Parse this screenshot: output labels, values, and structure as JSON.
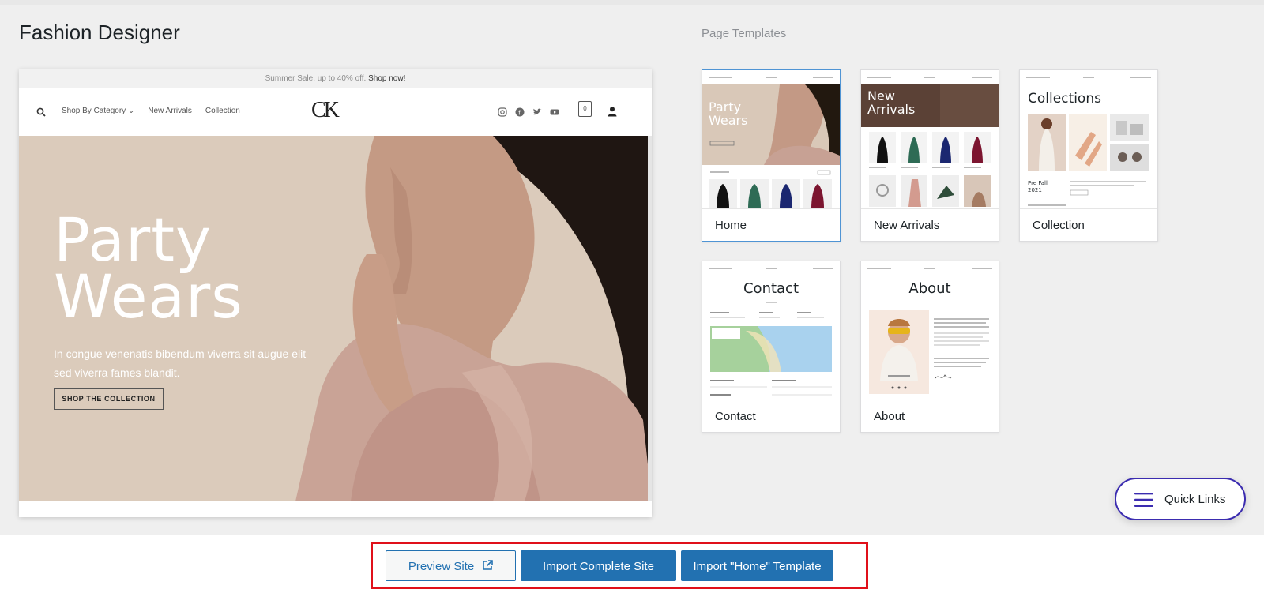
{
  "site_title": "Fashion Designer",
  "preview": {
    "announcement_text": "Summer Sale, up to 40% off.",
    "announcement_link": "Shop now!",
    "nav_links": [
      "Shop By Category ⌄",
      "New Arrivals",
      "Collection"
    ],
    "logo": "CK",
    "cart_count": "0",
    "hero_title": "Party\nWears",
    "hero_subtitle": "In congue venenatis bibendum viverra sit augue elit sed viverra fames blandit.",
    "hero_button": "SHOP THE COLLECTION"
  },
  "templates": {
    "heading": "Page Templates",
    "selected": "Home",
    "items": [
      {
        "label": "Home",
        "thumb_title": "Party Wears"
      },
      {
        "label": "New Arrivals",
        "thumb_title": "New Arrivals"
      },
      {
        "label": "Collection",
        "thumb_title": "Collections",
        "thumb_caption": "Pre Fall 2021"
      },
      {
        "label": "Contact",
        "thumb_title": "Contact"
      },
      {
        "label": "About",
        "thumb_title": "About"
      }
    ]
  },
  "quick_links": {
    "label": "Quick Links",
    "icon": "hamburger-icon"
  },
  "actions": {
    "preview_site": "Preview Site",
    "preview_icon": "external-link-icon",
    "import_site": "Import Complete Site",
    "import_template": "Import \"Home\" Template"
  },
  "colors": {
    "primary": "#2271b1",
    "highlight": "#e0101a",
    "quick_links_border": "#3b2cb0",
    "hero_bg": "#dbcbbb"
  }
}
